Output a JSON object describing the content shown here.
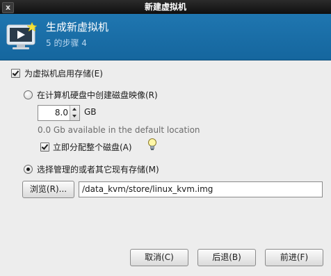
{
  "window": {
    "title": "新建虚拟机",
    "close_glyph": "x"
  },
  "banner": {
    "title": "生成新虚拟机",
    "step": "5 的步骤 4",
    "icon": "vm-monitor-star-icon"
  },
  "storage": {
    "enable_label": "为虚拟机启用存储(E)",
    "enable_checked": true,
    "create_image_label": "在计算机硬盘中创建磁盘映像(R)",
    "create_image_selected": false,
    "size_value": "8.0",
    "size_unit": "GB",
    "available_text": "0.0 Gb available in the default location",
    "allocate_label": "立即分配整个磁盘(A)",
    "allocate_checked": true,
    "existing_label": "选择管理的或者其它现有存储(M)",
    "existing_selected": true,
    "browse_label": "浏览(R)...",
    "path_value": "/data_kvm/store/linux_kvm.img"
  },
  "footer": {
    "cancel_label": "取消(C)",
    "back_label": "后退(B)",
    "forward_label": "前进(F)"
  },
  "colors": {
    "banner": "#1f76b0",
    "titlebar": "#1a1a1a",
    "background": "#ededed"
  }
}
